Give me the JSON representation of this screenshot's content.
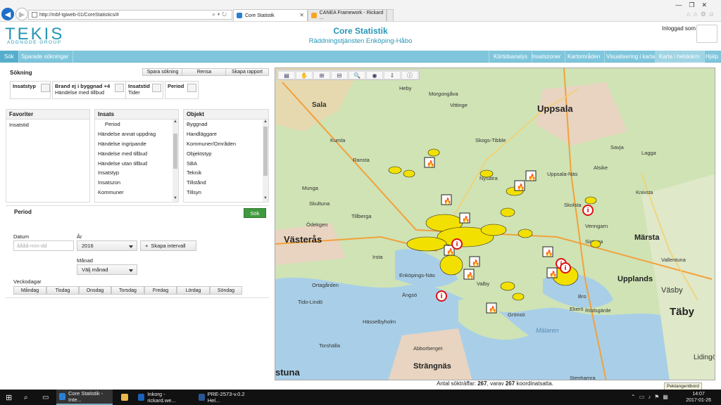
{
  "browser": {
    "url": "http://mbf-tgiweb-01/CoreStatistics/#",
    "tabs": [
      {
        "label": "Core Statistik"
      },
      {
        "label": "CANEA Framework - Rickard ..."
      }
    ]
  },
  "header": {
    "logo": "TEKIS",
    "logo_sub": "ADDNODE GROUP",
    "title": "Core Statistik",
    "subtitle": "Räddningstjänsten Enköping-Håbo",
    "logged_in": "Inloggad som"
  },
  "nav": {
    "left": [
      "Sök",
      "Sparade sökningar"
    ],
    "right": [
      "Körtidsanalys",
      "Insatszoner",
      "Kartområden",
      "Visualisering i karta",
      "Karta i helskärm",
      "Hjälp"
    ]
  },
  "search": {
    "title": "Sökning",
    "buttons": [
      "Spara sökning",
      "Rensa",
      "Skapa rapport"
    ],
    "criteria": [
      {
        "title": "Insatstyp",
        "detail": ""
      },
      {
        "title": "Brand ej i byggnad +4",
        "detail": "Händelse med tillbud"
      },
      {
        "title": "Insatstid",
        "detail": "Tider"
      },
      {
        "title": "Period",
        "detail": ""
      }
    ]
  },
  "favoriter": {
    "title": "Favoriter",
    "items": [
      "Insatstid"
    ]
  },
  "insats": {
    "title": "Insats",
    "items": [
      "Period",
      "Händelse annat uppdrag",
      "Händelse ingripande",
      "Händelse med tillbud",
      "Händelse utan tillbud",
      "Insatstyp",
      "Insatszon",
      "Kommuner"
    ]
  },
  "objekt": {
    "title": "Objekt",
    "items": [
      "Byggnad",
      "Handläggare",
      "Kommuner/Områden",
      "Objektstyp",
      "SBA",
      "Teknik",
      "Tillstånd",
      "Tillsyn"
    ]
  },
  "period": {
    "title": "Period",
    "search_button": "Sök",
    "datum_label": "Datum",
    "datum_placeholder": "åååå-mm-dd",
    "ar_label": "År",
    "ar_value": "2016",
    "interval_button": "Skapa intervall",
    "manad_label": "Månad",
    "manad_value": "Välj månad",
    "veckodagar_label": "Veckodagar",
    "days": [
      "Måndag",
      "Tisdag",
      "Onsdag",
      "Torsdag",
      "Fredag",
      "Lördag",
      "Söndag"
    ]
  },
  "map": {
    "tool_icons": [
      "layers-icon",
      "pan-icon",
      "zoom-box-icon",
      "zoom-box-out-icon",
      "zoom-icon",
      "globe-icon",
      "export-icon",
      "info-icon"
    ],
    "places_major": [
      "Uppsala",
      "Västerås",
      "Upplands",
      "Märsta",
      "Täby",
      "Strängnäs",
      "stuna"
    ],
    "places": [
      "Sala",
      "Heby",
      "Morgongåva",
      "Vittinge",
      "Skogs-Tibble",
      "Kumla",
      "Ransta",
      "Nysätra",
      "Uppsala-Näs",
      "Alsike",
      "Knivsta",
      "Lagga",
      "Savja",
      "Skultuna",
      "Munga",
      "Tillberga",
      "Irsta",
      "Sigtuna",
      "Vallentuna",
      "Väsby",
      "Ortagården",
      "Enköpings-Näs",
      "Ängsö",
      "Valby",
      "Grönsö",
      "Tido-Lindö",
      "Hässelbyholm",
      "Torshälla",
      "Abborberget",
      "Mälaren",
      "Bro",
      "Ekerö",
      "Stenhamra",
      "Skolsta",
      "Venngarn",
      "Lidingö",
      "Ödekgen",
      "Rödsgärde"
    ],
    "status_prefix": "Antal sökträffar:",
    "hits": "267",
    "status_mid": ", varav",
    "coords": "267",
    "status_suffix": "koordinatsatta.",
    "tooltip": "Pektangentbord"
  },
  "taskbar": {
    "items": [
      "Core Statistik - Inte...",
      "Inkorg - rickard.we...",
      "PRE-2573-v.0.2 Hel..."
    ],
    "time": "14:07",
    "date": "2017-01-26"
  },
  "colors": {
    "accent": "#2596b6",
    "nav": "#7fc6dd",
    "green": "#3f9a3f",
    "marker": "#f2e000"
  }
}
